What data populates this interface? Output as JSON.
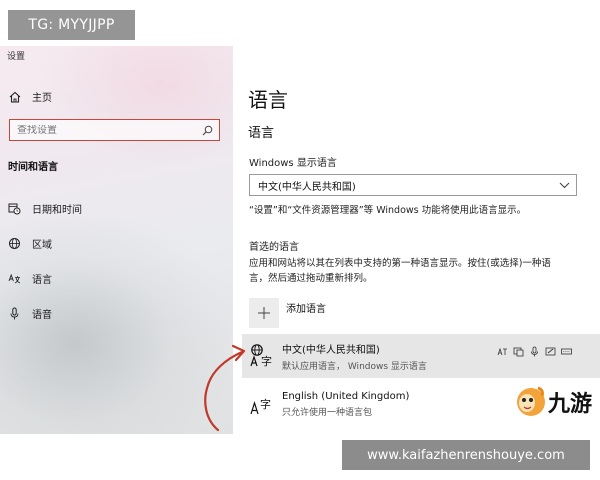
{
  "watermark_top": "TG: MYYJJPP",
  "watermark_bottom": "www.kaifazhenrenshouye.com",
  "logo_text": "九游",
  "sidebar": {
    "app_title": "设置",
    "home_label": "主页",
    "search_placeholder": "查找设置",
    "section_label": "时间和语言",
    "items": [
      {
        "label": "日期和时间",
        "icon": "calendar-clock-icon"
      },
      {
        "label": "区域",
        "icon": "globe-icon"
      },
      {
        "label": "语言",
        "icon": "language-icon"
      },
      {
        "label": "语音",
        "icon": "microphone-icon"
      }
    ]
  },
  "main": {
    "page_title": "语言",
    "section_title": "语言",
    "display_language_label": "Windows 显示语言",
    "display_language_value": "中文(中华人民共和国)",
    "display_language_note": "“设置”和“文件资源管理器”等 Windows 功能将使用此语言显示。",
    "preferred_label": "首选的语言",
    "preferred_note_line1": "应用和网站将以其在列表中支持的第一种语言显示。按住(或选择)一种语",
    "preferred_note_line2": "言，然后通过拖动重新排列。",
    "add_language_label": "添加语言",
    "languages": [
      {
        "name": "中文(中华人民共和国)",
        "sub": "默认应用语言， Windows 显示语言"
      },
      {
        "name": "English (United Kingdom)",
        "sub": "只允许使用一种语言包"
      }
    ]
  },
  "colors": {
    "search_border": "#c9463d",
    "arrow": "#c0392b",
    "selected_row": "#e6e6e6",
    "watermark_bg": "#828282"
  }
}
